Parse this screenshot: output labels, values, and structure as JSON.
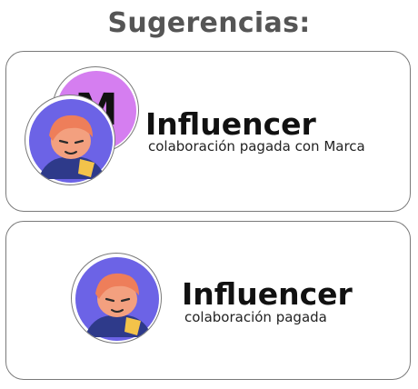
{
  "heading": "Sugerencias:",
  "suggestions": [
    {
      "brand_initial": "M",
      "title": "Influencer",
      "subtitle": "colaboración pagada con Marca"
    },
    {
      "title": "Influencer",
      "subtitle": "colaboración pagada"
    }
  ],
  "colors": {
    "brand_avatar_bg": "#d57ef0",
    "avatar_bg": "#6c63e6",
    "skin": "#f3a07f",
    "hair": "#ee7e5a",
    "shirt": "#2e3a8a",
    "shirt_accent": "#f3c34a"
  },
  "icons": {
    "brand_avatar": "brand-letter-avatar-icon",
    "influencer_avatar": "person-avatar-icon"
  }
}
